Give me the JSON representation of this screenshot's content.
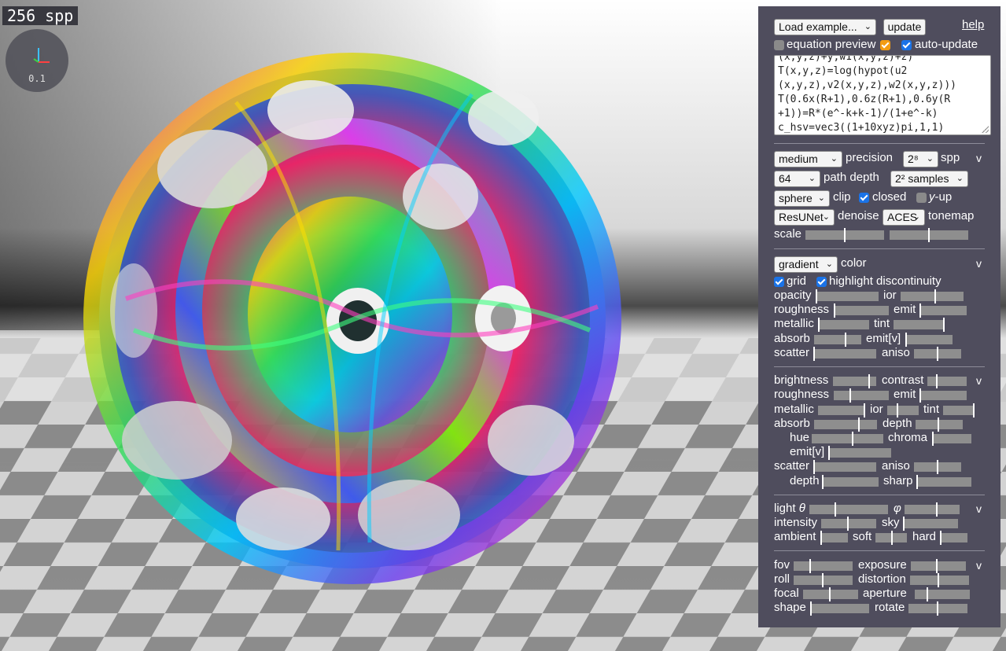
{
  "overlay": {
    "spp_text": "256 spp",
    "zoom_text": "0.1"
  },
  "panel": {
    "load_example": "Load example...",
    "update_label": "update",
    "help_label": "help",
    "equation_preview_label": "equation preview",
    "auto_update_label": "auto-update",
    "equation_lines": [
      "(x,y,z)+y,w1(x,y,z)+z)",
      "T(x,y,z)=log(hypot(u2",
      "(x,y,z),v2(x,y,z),w2(x,y,z)))",
      "T(0.6x(R+1),0.6z(R+1),0.6y(R",
      "+1))=R*(e^-k+k-1)/(1+e^-k)",
      "c_hsv=vec3((1+10xyz)pi,1,1)"
    ],
    "render": {
      "toggle": "v",
      "precision_value": "medium",
      "precision_label": "precision",
      "spp_value": "2⁸",
      "spp_label": "spp",
      "path_depth_value": "64",
      "path_depth_label": "path depth",
      "samples_value": "2² samples",
      "clip_value": "sphere",
      "clip_label": "clip",
      "closed_label": "closed",
      "yup_y": "y",
      "yup_rest": "-up",
      "denoise_value": "ResUNet",
      "denoise_label": "denoise",
      "tonemap_value": "ACES",
      "tonemap_label": "tonemap",
      "scale_label": "scale"
    },
    "material": {
      "toggle": "v",
      "color_value": "gradient",
      "color_label": "color",
      "grid_label": "grid",
      "highlight_label": "highlight discontinuity",
      "opacity": "opacity",
      "ior": "ior",
      "roughness": "roughness",
      "emit": "emit",
      "metallic": "metallic",
      "tint": "tint",
      "absorb": "absorb",
      "emit_v": "emit[v]",
      "scatter": "scatter",
      "aniso": "aniso"
    },
    "adjust": {
      "toggle": "v",
      "brightness": "brightness",
      "contrast": "contrast",
      "roughness": "roughness",
      "emit": "emit",
      "metallic": "metallic",
      "ior": "ior",
      "tint": "tint",
      "absorb": "absorb",
      "depth": "depth",
      "hue": "hue",
      "chroma": "chroma",
      "emit_v": "emit[v]",
      "scatter": "scatter",
      "aniso": "aniso",
      "depth2": "depth",
      "sharp": "sharp"
    },
    "light": {
      "toggle": "v",
      "light": "light",
      "theta": "θ",
      "phi": "φ",
      "intensity": "intensity",
      "sky": "sky",
      "ambient": "ambient",
      "soft": "soft",
      "hard": "hard"
    },
    "camera": {
      "toggle": "v",
      "fov": "fov",
      "exposure": "exposure",
      "roll": "roll",
      "distortion": "distortion",
      "focal": "focal",
      "aperture": "aperture",
      "shape": "shape",
      "rotate": "rotate"
    }
  },
  "colors": {
    "panel_bg": "#4f4d5d",
    "checkbox_on": "#1a73e8",
    "preview_toggle": "#f39c12"
  }
}
